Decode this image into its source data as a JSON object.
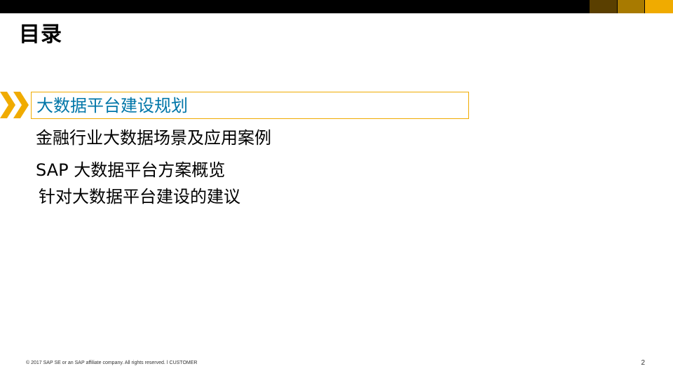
{
  "colors": {
    "top_bar": "#000000",
    "swatch_1": "#5a3f00",
    "swatch_2": "#a87a00",
    "swatch_3": "#f0ab00",
    "accent_gold": "#f0ab00",
    "active_text": "#0076a8"
  },
  "slide": {
    "title": "目录",
    "items": [
      {
        "label": "大数据平台建设规划"
      },
      {
        "label": "金融行业大数据场景及应用案例"
      },
      {
        "label": "SAP 大数据平台方案概览"
      },
      {
        "label": "针对大数据平台建设的建议"
      }
    ],
    "footer": "© 2017 SAP SE or an SAP affiliate company. All rights reserved.  ǀ  CUSTOMER",
    "page_number": "2"
  }
}
